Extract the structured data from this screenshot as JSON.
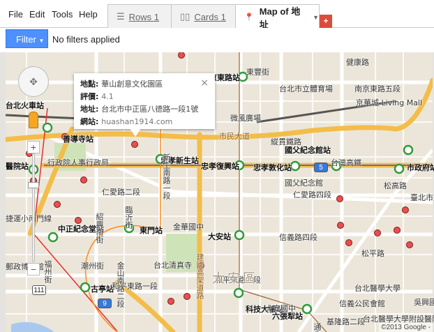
{
  "menu": [
    "File",
    "Edit",
    "Tools",
    "Help"
  ],
  "tabs": [
    {
      "label": "Rows 1",
      "icon": "rows-icon"
    },
    {
      "label": "Cards 1",
      "icon": "cards-icon"
    },
    {
      "label": "Map of 地址",
      "icon": "map-pin-icon"
    }
  ],
  "add_tab_label": "+",
  "filter": {
    "button": "Filter",
    "status": "No filters applied"
  },
  "colors": {
    "accent": "#4d90fe",
    "add_tab": "#dd4b39",
    "marker": "#e94f4f",
    "highway": "#f8c44c"
  },
  "info_window": {
    "rows": [
      {
        "key": "地點",
        "value": "華山創意文化園區"
      },
      {
        "key": "評價",
        "value": "4.1"
      },
      {
        "key": "地址",
        "value": "台北市中正區八德路一段1號"
      },
      {
        "key": "網站",
        "value": "huashan1914.com"
      }
    ],
    "close": "×"
  },
  "map": {
    "labels": [
      "台北火車站",
      "善導寺站",
      "忠孝新生站",
      "忠孝復興站",
      "忠孝敦化站",
      "國父紀念館站",
      "市政府站",
      "東門站",
      "中正紀念堂站",
      "醫院站",
      "大安站",
      "科技大樓站",
      "六張犁站",
      "古亭站",
      "京東路站",
      "市民大道",
      "縱貫鐵路",
      "台灣高鐵",
      "台北市立體育場",
      "南京東路五段",
      "京華城 Living Mall",
      "微風廣場",
      "國父紀念館",
      "行政院人事行政局",
      "仁愛路二段",
      "仁愛路四段",
      "信義路四段",
      "和平東路一段",
      "和平東路二段",
      "金華國中",
      "台北清真寺",
      "大安國中",
      "信義公民會館",
      "松平路",
      "松高路",
      "台北醫學大學附設醫院",
      "台北醫學大學",
      "臺北市立高級中",
      "郵政博物館",
      "潮州街",
      "福州街",
      "金山南路二段",
      "新生南路一段",
      "建國高架道路",
      "大安區",
      "健康路",
      "捷運小南門線",
      "臨沂街",
      "紹興南街",
      "通化街",
      "基隆路二段",
      "吳興國小",
      "東豐街",
      "5",
      "9",
      "111"
    ],
    "copyright": "©2013 Google -"
  },
  "controls": {
    "zoom_in": "+",
    "zoom_out": "−"
  }
}
